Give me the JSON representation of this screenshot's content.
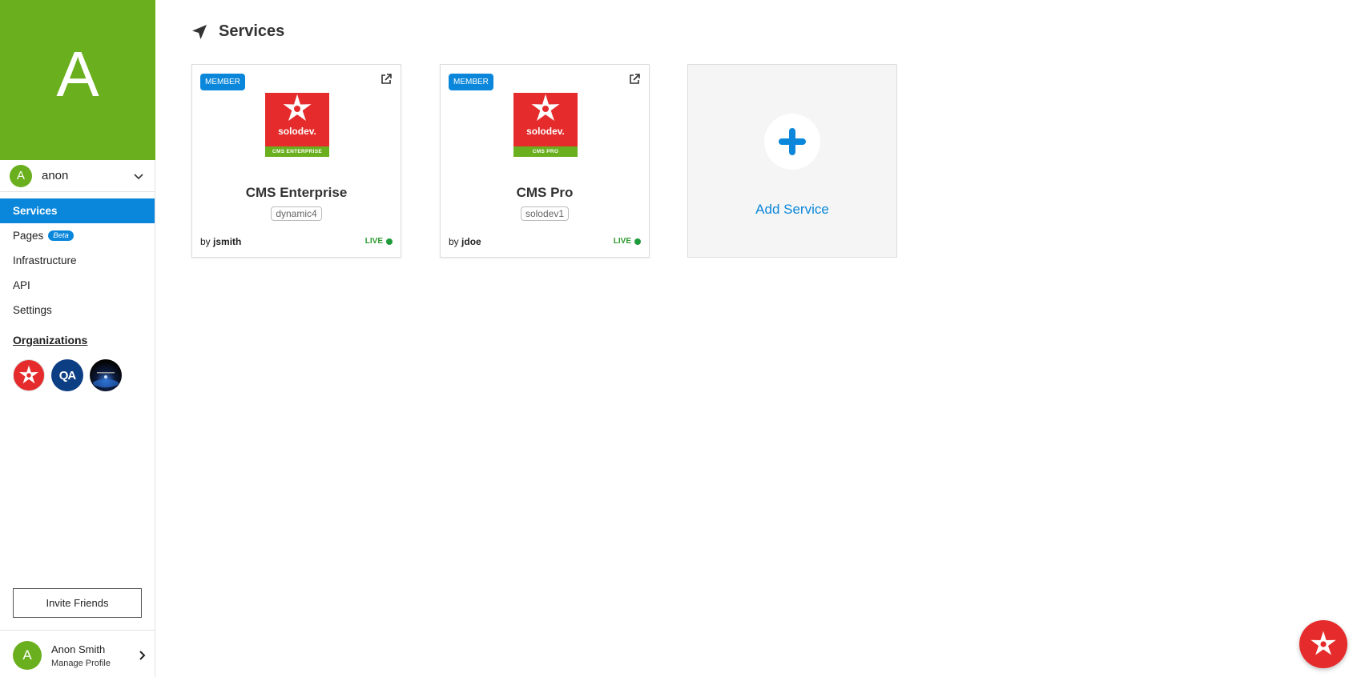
{
  "sidebar": {
    "hero_letter": "A",
    "account": {
      "avatar_letter": "A",
      "name": "anon"
    },
    "nav": [
      {
        "label": "Services",
        "active": true
      },
      {
        "label": "Pages",
        "badge": "Beta"
      },
      {
        "label": "Infrastructure"
      },
      {
        "label": "API"
      },
      {
        "label": "Settings"
      }
    ],
    "organizations_title": "Organizations",
    "organizations": [
      {
        "name": "solodev",
        "icon": "solodev-star-icon"
      },
      {
        "name": "QA",
        "label": "QA"
      },
      {
        "name": "space",
        "icon": "space-globe-icon"
      }
    ],
    "invite_label": "Invite Friends",
    "profile": {
      "avatar_letter": "A",
      "name": "Anon Smith",
      "sub": "Manage Profile"
    }
  },
  "main": {
    "title": "Services",
    "title_icon": "navigation-arrow-icon",
    "cards": [
      {
        "badge": "MEMBER",
        "logo_word": "solodev.",
        "logo_sub": "CMS ENTERPRISE",
        "title": "CMS Enterprise",
        "tag": "dynamic4",
        "by": "by",
        "author": "jsmith",
        "status": "LIVE"
      },
      {
        "badge": "MEMBER",
        "logo_word": "solodev.",
        "logo_sub": "CMS PRO",
        "title": "CMS Pro",
        "tag": "solodev1",
        "by": "by",
        "author": "jdoe",
        "status": "LIVE"
      }
    ],
    "add_service_label": "Add Service"
  },
  "colors": {
    "brand_green": "#6aaf1d",
    "accent_blue": "#0a87db",
    "solodev_red": "#e52b2b",
    "live_green": "#1e9a3a"
  }
}
